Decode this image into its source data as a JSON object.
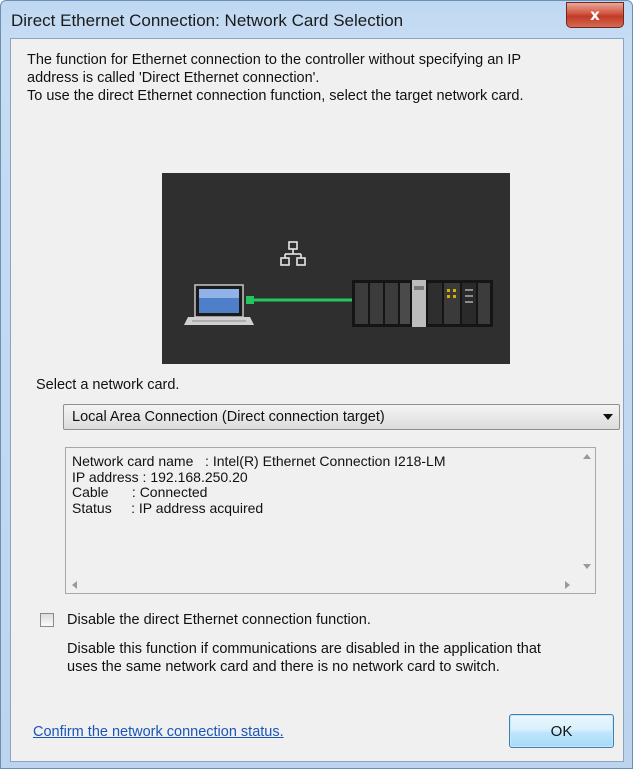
{
  "window": {
    "title": "Direct Ethernet Connection: Network Card Selection",
    "close_glyph": "x"
  },
  "intro": {
    "line1": "The function for Ethernet connection to the controller without specifying an IP",
    "line2": "address is called 'Direct Ethernet connection'.",
    "line3": "To use the direct Ethernet connection function, select the target network card."
  },
  "diagram": {
    "icons": [
      "laptop-icon",
      "network-icon",
      "controller-icon"
    ],
    "colors": {
      "background": "#2f2f2f",
      "connection": "#22c55e"
    }
  },
  "network_card": {
    "label": "Select a network card.",
    "selected": "Local Area Connection (Direct connection target)"
  },
  "info": {
    "lines": [
      "Network card name   : Intel(R) Ethernet Connection I218-LM",
      "IP address : 192.168.250.20",
      "Cable      : Connected",
      "Status     : IP address acquired"
    ]
  },
  "disable_option": {
    "label": "Disable the direct Ethernet connection function.",
    "checked": false,
    "desc_line1": "Disable this function if communications are disabled in the application that",
    "desc_line2": "uses the same network card and there is no network card to switch."
  },
  "footer": {
    "link": "Confirm the network connection status.",
    "ok_label": "OK"
  }
}
